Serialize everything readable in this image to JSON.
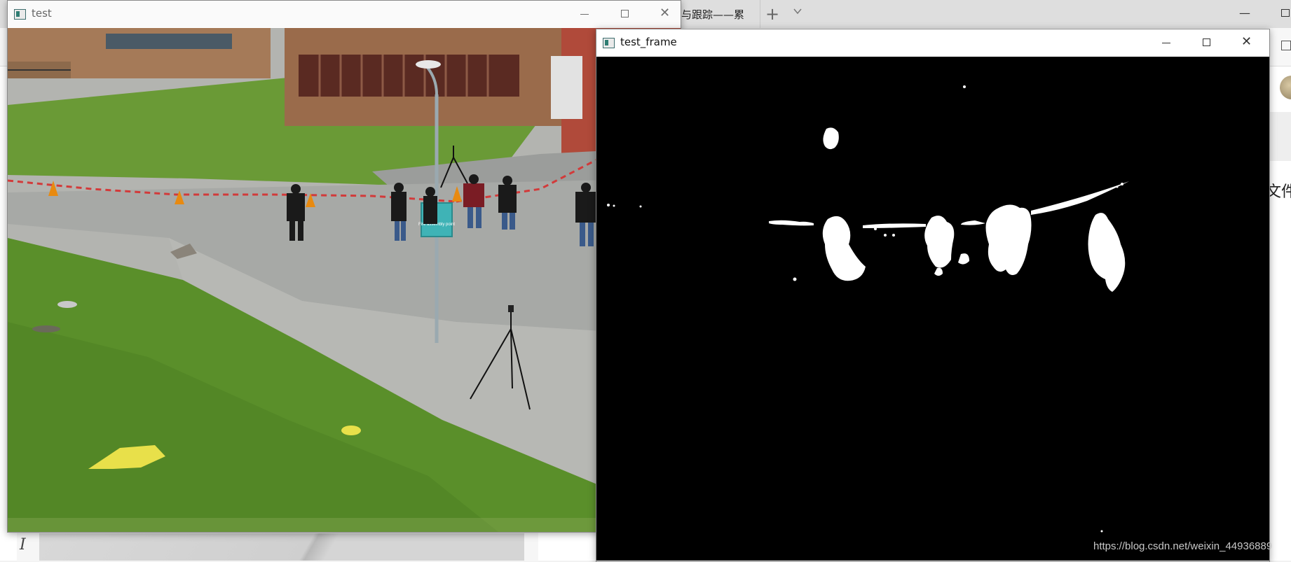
{
  "browser": {
    "tab_title": "与跟踪——累",
    "new_tab_symbol": "+",
    "minimize_symbol": "—",
    "side_text": "文件"
  },
  "windows": {
    "test": {
      "title": "test",
      "minimize_icon": "minimize-icon",
      "maximize_icon": "maximize-icon",
      "close_symbol": "✕"
    },
    "test_frame": {
      "title": "test_frame",
      "minimize_icon": "minimize-icon",
      "maximize_icon": "maximize-icon",
      "close_symbol": "✕"
    }
  },
  "scene": {
    "sign_text": "Fire assembly point"
  },
  "watermark": "https://blog.csdn.net/weixin_44936889",
  "colors": {
    "grass": "#5a8f2a",
    "asphalt": "#b3b4b0",
    "brick": "#9a6b4b",
    "mask_background": "#000000",
    "mask_foreground": "#ffffff",
    "sign": "#3fb3b6"
  }
}
